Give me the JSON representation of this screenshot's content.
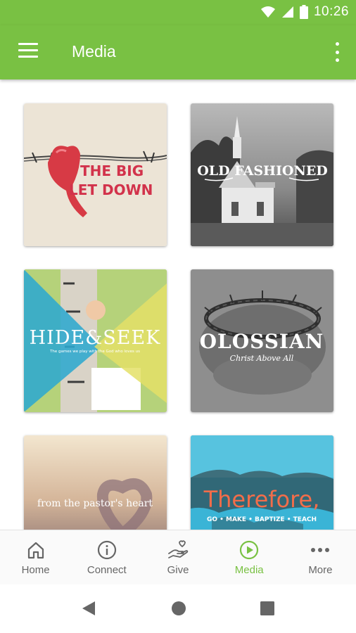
{
  "status_bar": {
    "time": "10:26"
  },
  "app_bar": {
    "title": "Media"
  },
  "media": [
    {
      "title": "The Big Let Down",
      "line1": "THE BIG",
      "line2": "LET DOWN"
    },
    {
      "title": "Old Fashioned",
      "line1": "OLD FASHIONED"
    },
    {
      "title": "Hide & Seek",
      "line1": "HIDE&SEEK",
      "subtitle": "The games we play with the God who loves us"
    },
    {
      "title": "Colossians",
      "line1": "OLOSSIAN",
      "subtitle": "Christ Above All"
    },
    {
      "title": "From the Pastor's Heart",
      "line1": "from the pastor's heart"
    },
    {
      "title": "Therefore",
      "line1": "Therefore,",
      "subtitle": "GO • MAKE • BAPTIZE • TEACH"
    }
  ],
  "bottom_nav": [
    {
      "label": "Home",
      "icon": "home-icon"
    },
    {
      "label": "Connect",
      "icon": "info-icon"
    },
    {
      "label": "Give",
      "icon": "give-icon"
    },
    {
      "label": "Media",
      "icon": "play-icon",
      "active": true
    },
    {
      "label": "More",
      "icon": "more-dots-icon"
    }
  ],
  "colors": {
    "accent": "#79c143",
    "inactive": "#666666"
  }
}
